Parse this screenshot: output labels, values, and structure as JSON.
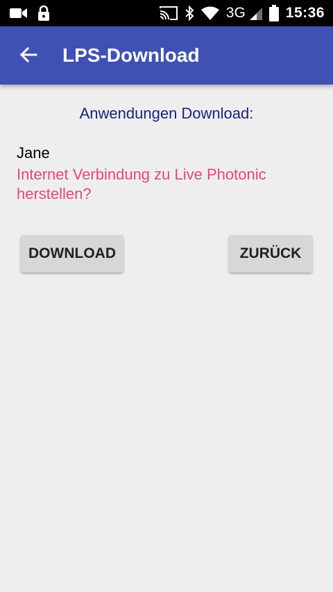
{
  "status_bar": {
    "left_icons": [
      "video-camera-icon",
      "lock-icon"
    ],
    "right_icons": [
      "cast-icon",
      "bluetooth-icon",
      "wifi-icon",
      "cell-signal-icon",
      "battery-icon"
    ],
    "network": "3G",
    "time": "15:36"
  },
  "app_bar": {
    "back_icon": "arrow-back-icon",
    "title": "LPS-Download",
    "color": "#3f51b5"
  },
  "content": {
    "heading": "Anwendungen Download:",
    "user": "Jane",
    "message": "Internet Verbindung zu Live Photonic herstellen?",
    "message_color": "#e8457c"
  },
  "buttons": {
    "download": "DOWNLOAD",
    "back": "ZURÜCK"
  }
}
